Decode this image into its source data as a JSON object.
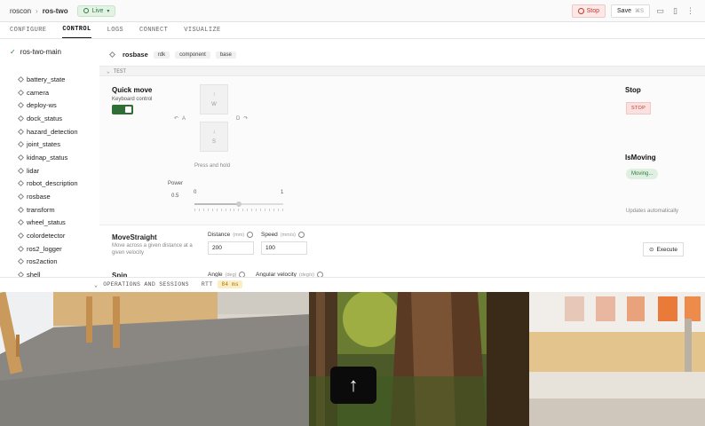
{
  "breadcrumb": {
    "org": "roscon",
    "machine": "ros-two"
  },
  "status": {
    "live": "Live"
  },
  "header": {
    "stop_label": "Stop",
    "save_label": "Save",
    "save_shortcut": "⌘S"
  },
  "tabs": [
    "CONFIGURE",
    "CONTROL",
    "LOGS",
    "CONNECT",
    "VISUALIZE"
  ],
  "sidebar": {
    "main": "ros-two-main",
    "items": [
      "battery_state",
      "camera",
      "deploy-ws",
      "dock_status",
      "hazard_detection",
      "joint_states",
      "kidnap_status",
      "lidar",
      "robot_description",
      "rosbase",
      "transform",
      "wheel_status",
      "colordetector",
      "ros2_logger",
      "ros2action",
      "shell"
    ]
  },
  "resource": {
    "name": "rosbase",
    "chips": [
      "rdk",
      "component",
      "base"
    ],
    "section": "TEST"
  },
  "quick_move": {
    "title": "Quick move",
    "keyboard_label": "Keyboard control",
    "keyboard_enabled": true,
    "keys": {
      "up_arrow": "↑",
      "up_key": "W",
      "down_arrow": "↓",
      "down_key": "S",
      "left_rot": "↶",
      "left_key": "A",
      "right_key": "D",
      "right_rot": "↷"
    },
    "hint": "Press and hold",
    "power_label": "Power",
    "power_value": "0.5",
    "slider_min": "0",
    "slider_max": "1",
    "slider_fraction": 0.5
  },
  "stop_panel": {
    "title": "Stop",
    "button": "STOP"
  },
  "is_moving": {
    "title": "IsMoving",
    "value": "Moving...",
    "note": "Updates automatically"
  },
  "move_straight": {
    "title": "MoveStraight",
    "desc": "Move across a given distance at a given velocity",
    "distance_label": "Distance",
    "distance_unit": "(mm)",
    "distance_value": "200",
    "speed_label": "Speed",
    "speed_unit": "(mm/s)",
    "speed_value": "100",
    "execute": "Execute"
  },
  "spin": {
    "title": "Spin",
    "angle_label": "Angle",
    "angle_unit": "(deg)",
    "velocity_label": "Angular velocity",
    "velocity_unit": "(deg/s)"
  },
  "ops_bar": {
    "label": "OPERATIONS AND SESSIONS",
    "rtt_label": "RTT",
    "rtt_value": "84 ms"
  },
  "camera_overlay": {
    "arrow": "↑"
  },
  "colors": {
    "accent_green": "#2f6e35",
    "stop_red": "#c0392b",
    "rtt_amber": "#fbeec5"
  }
}
